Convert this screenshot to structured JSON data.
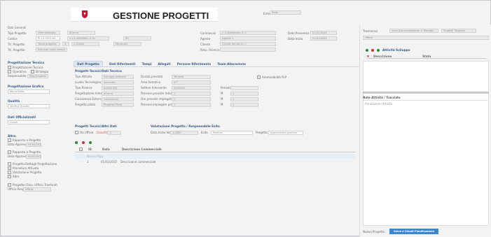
{
  "app": {
    "title": "GESTIONE PROGETTI",
    "logo_color": "#c8102e",
    "blue_button_color": "#3a86d1"
  },
  "top_left": {
    "caption": "Dati Generali",
    "fields": [
      {
        "label": "Tipo Progetto",
        "value": "Internazionale",
        "value2": "Interno"
      },
      {
        "label": "Codice",
        "value": "PI-14-0002/AS",
        "value2": "1-11-00000001-S-01",
        "value3": "R2"
      },
      {
        "label": "Tit. Progetto",
        "value": "Titolo progetto",
        "value2": "1",
        "value3": "C-Livello",
        "value4": "Personale"
      },
      {
        "label": "Tit. Progetto",
        "value": "Sviluppo nuovi servizi"
      }
    ]
  },
  "top_right": {
    "ente": {
      "label": "Ente",
      "value": "Sede"
    },
    "fields": [
      {
        "label": "Commessa",
        "value": "C.O.Gestionale S.r.l."
      },
      {
        "label": "Agente",
        "value": "Agente 1"
      },
      {
        "label": "Cliente",
        "value": "Cliente Servizi S.r.l."
      },
      {
        "label": "Resp. Ricerca",
        "value": ""
      }
    ],
    "dates": [
      {
        "label": "Data Presentaz.",
        "value": "01/12/2014"
      },
      {
        "label": "Data Inizio",
        "value": "01/01/2015"
      }
    ]
  },
  "left_panel": {
    "sec1": {
      "title": "Progettazione Tecnica",
      "items": [
        "Progettazione Tecnica",
        "Operativo",
        "Strategia"
      ],
      "field_label": "Responsabile",
      "field_value": "Responsabile"
    },
    "sec2": {
      "title": "Progettazione Grafica",
      "field": "Mario Rossi"
    },
    "sec3": {
      "title": "Qualità",
      "field": "Verifica Qualità"
    },
    "sec4": {
      "title": "Dati Ufficializzati",
      "field": "Luogo"
    },
    "sec5": {
      "title": "Altro",
      "items": [
        {
          "label": "Rapporto a Progetto",
          "sub_label": "Data Approvaz.",
          "sub_value": "01/01/2015"
        },
        {
          "label": "Rapporto a Progetto",
          "sub_label": "Data Approvaz.",
          "sub_value": "01/01/2015"
        }
      ],
      "more": [
        "Progetto Dettagli Progettazione",
        "Procedura Attivata",
        "Valutazione Progetto",
        "Altro"
      ],
      "bottom_check": "Progetto Class. Ufficio Trasferim.",
      "bottom_label": "Ufficio Resp.",
      "bottom_value": "Ufficio"
    }
  },
  "tabs": [
    "Dati Progetto",
    "Dati Riferimenti",
    "Tempi",
    "Allegati",
    "Persone Riferimento",
    "Team Allocazione"
  ],
  "active_tab": 0,
  "pt": {
    "title": "Progetti Tecnici/Dati Tecnica",
    "rows": [
      {
        "l": "Tipo Attività",
        "v": "Sviluppo software",
        "l2": "Durata prevista",
        "v2": "36 mesi"
      },
      {
        "l": "Livello Tecnologico",
        "v": "Avanzato",
        "l2": "Area tematica",
        "v2": "ICT"
      },
      {
        "l": "Tipo Ricerca",
        "v": "Industriale",
        "l2": "Settore Intervento",
        "v2": "Industria",
        "l3": "Periodo",
        "v3": ""
      },
      {
        "l": "Progettazione Interna",
        "v": "Interna",
        "l2": "Persone previste totali",
        "v2": "1",
        "l3": "M",
        "v3": "1"
      },
      {
        "l": "Consulenza Esterna",
        "v": "Consulenza",
        "l2": "Ore previste impiegate",
        "v2": "1",
        "l3": "M",
        "v3": "1"
      },
      {
        "l": "Progetto pilota",
        "v": "Progetto Pilota",
        "l2": "Persone impiegate prolungato",
        "v2": "1",
        "l3": "M",
        "v3": "1"
      }
    ],
    "check_label": "Ammissibilità PLP"
  },
  "pt2": {
    "title": "Progetti Tecnici/Altri Dati",
    "check": "Da Ufficio",
    "cls": "Classifica",
    "val": "2",
    "title2": "Valutazione Progetto / Responsabile Esito",
    "tipo_label": "Data Inizio Valuta.",
    "tipo_value": "1.0000",
    "esito_label": "Esito",
    "esito_value": "Positivo",
    "proj_label": "Progetto",
    "proj_value": "Applicazione positiva"
  },
  "table": {
    "headers": [
      "ID",
      "Data",
      "Descrizione Commerciale"
    ],
    "rows": [
      {
        "id": "1",
        "date": "01/01/2015",
        "desc": "Descrizione commerciale"
      }
    ],
    "new_row": "Nuova Riga"
  },
  "right": {
    "label1": "Trasmesso",
    "btn1": "Invio Documentazione > Rimodul",
    "btn2": "Progetti Trasporti",
    "field1": "Ufficio",
    "tree_title": "Attività Sviluppo",
    "tree_col1": "Descrizione",
    "tree_col2": "Stato",
    "notes_title": "Note Attività / Tracciato",
    "notes_text": "Annotazioni Attività",
    "footer_label": "Nuovo Progetto",
    "footer_btn": "Salva e Chiudi Pianificazione"
  }
}
